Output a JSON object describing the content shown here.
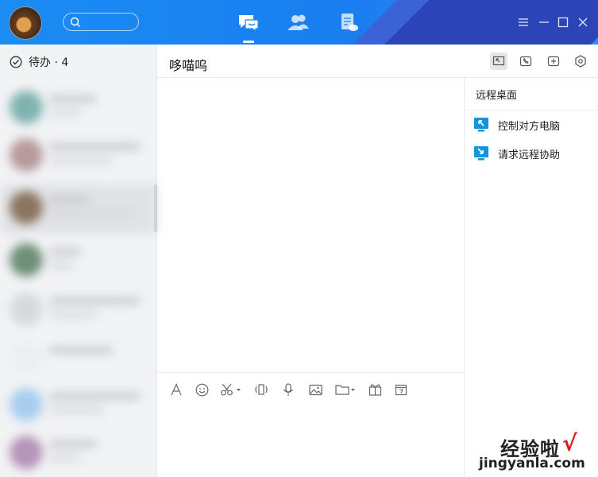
{
  "topbar": {
    "search": {
      "placeholder": ""
    },
    "nav": [
      {
        "name": "messages",
        "icon": "chat-bubble-icon",
        "active": true
      },
      {
        "name": "contacts",
        "icon": "contacts-icon"
      },
      {
        "name": "docs",
        "icon": "document-cloud-icon"
      }
    ],
    "window_controls": [
      "menu-icon",
      "minimize-icon",
      "maximize-icon",
      "close-icon"
    ],
    "colors": {
      "primary": "#1a8cf2",
      "stripe_light": "#3b63d8",
      "stripe_dark": "#2b45b8"
    }
  },
  "sidebar": {
    "todo_label": "待办 · 4"
  },
  "chat": {
    "title": "哆喵呜",
    "header_icons": [
      "remote-desktop-icon",
      "phone-icon",
      "add-icon",
      "settings-hex-icon"
    ]
  },
  "side_panel": {
    "title": "远程桌面",
    "items": [
      {
        "label": "控制对方电脑",
        "icon": "remote-control-icon"
      },
      {
        "label": "请求远程协助",
        "icon": "remote-assist-icon"
      }
    ],
    "accent": "#1296db"
  },
  "toolbar": {
    "tools": [
      "font-icon",
      "emoji-icon",
      "screenshot-icon",
      "shake-icon",
      "voice-icon",
      "image-icon",
      "folder-icon",
      "gift-icon",
      "calendar-icon"
    ]
  },
  "watermark": {
    "cn": "经验啦",
    "check": "√",
    "en": "jingyanla.com"
  }
}
